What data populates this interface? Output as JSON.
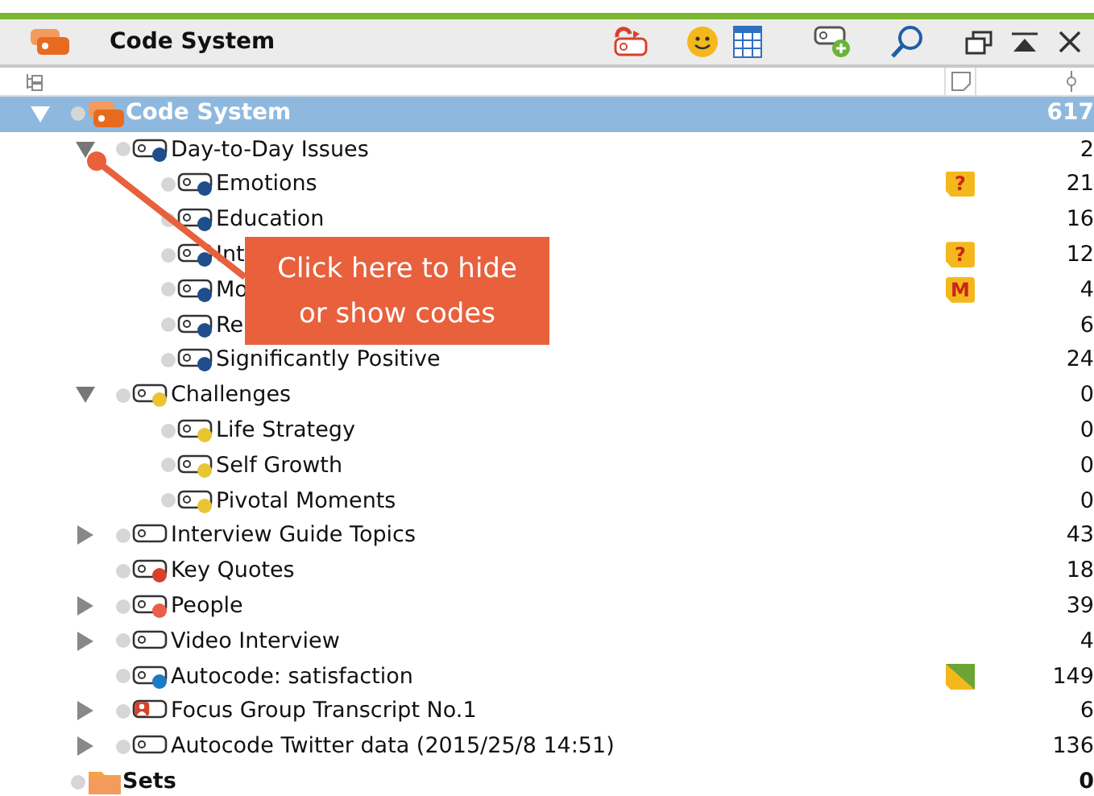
{
  "window": {
    "title": "Code System"
  },
  "tree": [
    {
      "label": "Code System",
      "count": "617",
      "kind": "root",
      "selected": true,
      "expanded": true,
      "children": [
        {
          "label": "Day-to-Day Issues",
          "count": "2",
          "kind": "code",
          "color": "#1f4e8c",
          "selected": false,
          "expanded": true,
          "children": [
            {
              "label": "Emotions",
              "count": "21",
              "kind": "code",
              "color": "#1f4e8c",
              "selected": false,
              "memo": {
                "kind": "tag",
                "text": "?"
              }
            },
            {
              "label": "Education",
              "count": "16",
              "kind": "code",
              "color": "#1f4e8c",
              "selected": false
            },
            {
              "label": "Int",
              "count": "12",
              "kind": "code",
              "color": "#1f4e8c",
              "selected": false,
              "memo": {
                "kind": "tag",
                "text": "?"
              }
            },
            {
              "label": "Mo",
              "count": "4",
              "kind": "code",
              "color": "#1f4e8c",
              "selected": false,
              "memo": {
                "kind": "tag",
                "text": "M"
              }
            },
            {
              "label": "Re",
              "count": "6",
              "kind": "code",
              "color": "#1f4e8c",
              "selected": false
            },
            {
              "label": "Significantly Positive",
              "count": "24",
              "kind": "code",
              "color": "#1f4e8c",
              "selected": false
            }
          ]
        },
        {
          "label": "Challenges",
          "count": "0",
          "kind": "code",
          "color": "#e8c532",
          "selected": false,
          "expanded": true,
          "children": [
            {
              "label": "Life Strategy",
              "count": "0",
              "kind": "code",
              "color": "#e8c532",
              "selected": false
            },
            {
              "label": "Self Growth",
              "count": "0",
              "kind": "code",
              "color": "#e8c532",
              "selected": false
            },
            {
              "label": "Pivotal Moments",
              "count": "0",
              "kind": "code",
              "color": "#e8c532",
              "selected": false
            }
          ]
        },
        {
          "label": "Interview Guide Topics",
          "count": "43",
          "kind": "code",
          "selected": false,
          "expanded": false
        },
        {
          "label": "Key Quotes",
          "count": "18",
          "kind": "code",
          "color": "#d9402b",
          "selected": false
        },
        {
          "label": "People",
          "count": "39",
          "kind": "code",
          "color": "#e8604c",
          "selected": false,
          "expanded": false
        },
        {
          "label": "Video Interview",
          "count": "4",
          "kind": "code",
          "selected": false,
          "expanded": false
        },
        {
          "label": "Autocode: satisfaction",
          "count": "149",
          "kind": "code",
          "color": "#1a7cc4",
          "selected": false,
          "memo": {
            "kind": "autocode"
          }
        },
        {
          "label": "Focus Group Transcript No.1",
          "count": "6",
          "kind": "focus-group",
          "selected": false,
          "expanded": false
        },
        {
          "label": "Autocode Twitter data (2015/25/8 14:51)",
          "count": "136",
          "kind": "code",
          "selected": false,
          "expanded": false
        }
      ]
    },
    {
      "label": "Sets",
      "count": "0",
      "kind": "sets",
      "selected": false
    }
  ],
  "callout": {
    "text": "Click here to hide or show codes"
  }
}
